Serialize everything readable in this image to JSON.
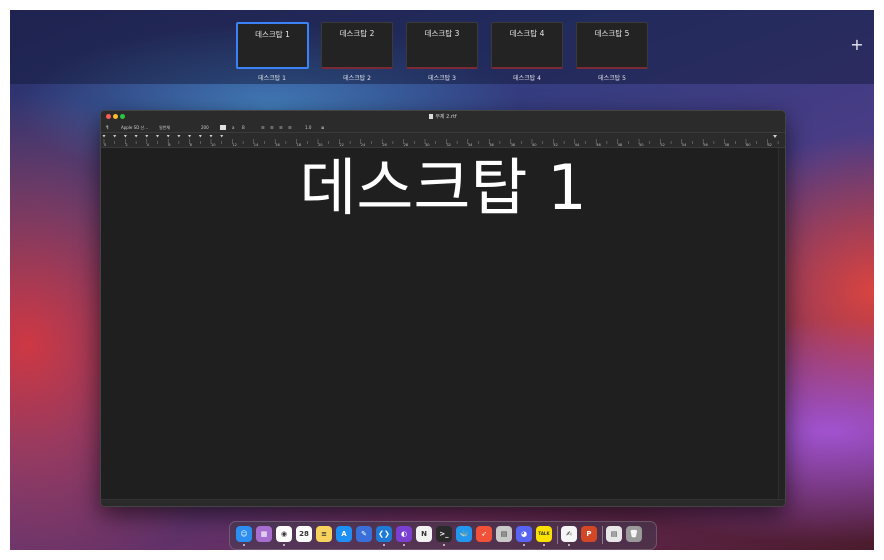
{
  "spaces": [
    {
      "thumb_title": "데스크탑 1",
      "label": "데스크탑 1",
      "active": true
    },
    {
      "thumb_title": "데스크탑 2",
      "label": "데스크탑 2",
      "active": false
    },
    {
      "thumb_title": "데스크탑 3",
      "label": "데스크탑 3",
      "active": false
    },
    {
      "thumb_title": "데스크탑 4",
      "label": "데스크탑 4",
      "active": false
    },
    {
      "thumb_title": "데스크탑 5",
      "label": "데스크탑 5",
      "active": false
    }
  ],
  "add_space_symbol": "+",
  "window": {
    "title": "무제 2.rtf",
    "toolbar": {
      "paragraph_symbol": "¶",
      "font_name": "Apple SD 산…",
      "font_style": "일반체",
      "font_size": "200",
      "color_a": "a",
      "size_b": "B",
      "line_spacing": "1.0"
    },
    "ruler_labels": [
      "0",
      "2",
      "4",
      "6",
      "8",
      "10",
      "12",
      "14",
      "16",
      "18",
      "20",
      "22",
      "24",
      "26",
      "28",
      "30",
      "32",
      "34",
      "36",
      "38",
      "40",
      "42",
      "44",
      "46",
      "48",
      "50",
      "52",
      "54",
      "56",
      "58",
      "60",
      "62"
    ],
    "text": "데스크탑 1"
  },
  "dock": [
    {
      "name": "finder-icon",
      "color": "#2b8ef0",
      "glyph": "☺",
      "running": true
    },
    {
      "name": "launchpad-icon",
      "color": "#a66fcf",
      "glyph": "▦",
      "running": false
    },
    {
      "name": "chrome-icon",
      "color": "#ffffff",
      "glyph": "◉",
      "running": true
    },
    {
      "name": "calendar-icon",
      "color": "#ffffff",
      "glyph": "28",
      "running": false
    },
    {
      "name": "notes-icon",
      "color": "#f7d25c",
      "glyph": "≡",
      "running": false
    },
    {
      "name": "app-store-icon",
      "color": "#1e8ff5",
      "glyph": "A",
      "running": false
    },
    {
      "name": "xcode-icon",
      "color": "#3a6fd9",
      "glyph": "✎",
      "running": false
    },
    {
      "name": "vscode-icon",
      "color": "#1f7ad6",
      "glyph": "❮❯",
      "running": true
    },
    {
      "name": "github-desktop-icon",
      "color": "#7a3fd1",
      "glyph": "◐",
      "running": true
    },
    {
      "name": "notion-icon",
      "color": "#f2f2f2",
      "glyph": "N",
      "running": false
    },
    {
      "name": "terminal-icon",
      "color": "#2a2a2a",
      "glyph": ">_",
      "running": true
    },
    {
      "name": "docker-icon",
      "color": "#2396ed",
      "glyph": "🐳",
      "running": false
    },
    {
      "name": "swift-playgrounds-icon",
      "color": "#f05138",
      "glyph": "➶",
      "running": false
    },
    {
      "name": "sequel-pro-icon",
      "color": "#c9c9c9",
      "glyph": "▤",
      "running": false
    },
    {
      "name": "discord-icon",
      "color": "#5865f2",
      "glyph": "◕",
      "running": true
    },
    {
      "name": "kakaotalk-icon",
      "color": "#fae100",
      "glyph": "TALK",
      "running": true
    },
    {
      "name": "textedit-icon",
      "color": "#f5f5f5",
      "glyph": "✍",
      "running": true
    },
    {
      "name": "powerpoint-icon",
      "color": "#d24726",
      "glyph": "P",
      "running": false
    },
    {
      "name": "documents-folder-icon",
      "color": "#e8e8e8",
      "glyph": "▤",
      "running": false
    },
    {
      "name": "trash-icon",
      "color": "#9a9a9a",
      "glyph": "🗑",
      "running": false
    }
  ],
  "colors": {
    "accent": "#3b82f6",
    "window_bg": "#1f1f1f",
    "toolbar_bg": "#2b2b2b"
  }
}
